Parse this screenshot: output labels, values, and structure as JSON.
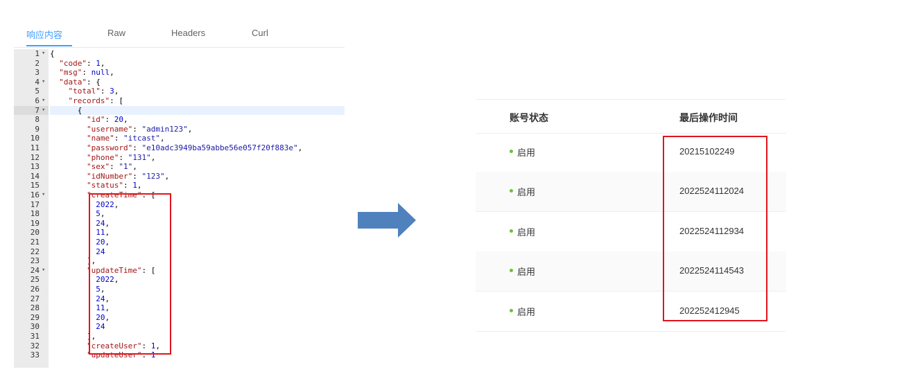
{
  "tabs": [
    {
      "label": "响应内容"
    },
    {
      "label": "Raw"
    },
    {
      "label": "Headers"
    },
    {
      "label": "Curl"
    }
  ],
  "active_tab": "响应内容",
  "code_lines": [
    {
      "n": "1",
      "fold": true,
      "text": "{"
    },
    {
      "n": "2",
      "text": "  \"code\": 1,"
    },
    {
      "n": "3",
      "text": "  \"msg\": null,"
    },
    {
      "n": "4",
      "fold": true,
      "text": "  \"data\": {"
    },
    {
      "n": "5",
      "text": "    \"total\": 3,"
    },
    {
      "n": "6",
      "fold": true,
      "text": "    \"records\": ["
    },
    {
      "n": "7",
      "fold": true,
      "active": true,
      "text": "      {"
    },
    {
      "n": "8",
      "text": "        \"id\": 20,"
    },
    {
      "n": "9",
      "text": "        \"username\": \"admin123\","
    },
    {
      "n": "10",
      "text": "        \"name\": \"itcast\","
    },
    {
      "n": "11",
      "text": "        \"password\": \"e10adc3949ba59abbe56e057f20f883e\","
    },
    {
      "n": "12",
      "text": "        \"phone\": \"131\","
    },
    {
      "n": "13",
      "text": "        \"sex\": \"1\","
    },
    {
      "n": "14",
      "text": "        \"idNumber\": \"123\","
    },
    {
      "n": "15",
      "text": "        \"status\": 1,"
    },
    {
      "n": "16",
      "fold": true,
      "text": "        \"createTime\": ["
    },
    {
      "n": "17",
      "text": "          2022,"
    },
    {
      "n": "18",
      "text": "          5,"
    },
    {
      "n": "19",
      "text": "          24,"
    },
    {
      "n": "20",
      "text": "          11,"
    },
    {
      "n": "21",
      "text": "          20,"
    },
    {
      "n": "22",
      "text": "          24"
    },
    {
      "n": "23",
      "text": "        ],"
    },
    {
      "n": "24",
      "fold": true,
      "text": "        \"updateTime\": ["
    },
    {
      "n": "25",
      "text": "          2022,"
    },
    {
      "n": "26",
      "text": "          5,"
    },
    {
      "n": "27",
      "text": "          24,"
    },
    {
      "n": "28",
      "text": "          11,"
    },
    {
      "n": "29",
      "text": "          20,"
    },
    {
      "n": "30",
      "text": "          24"
    },
    {
      "n": "31",
      "text": "        ],"
    },
    {
      "n": "32",
      "text": "        \"createUser\": 1,"
    },
    {
      "n": "33",
      "text": "        \"updateUser\": 1"
    }
  ],
  "table": {
    "headers": {
      "status": "账号状态",
      "time": "最后操作时间"
    },
    "rows": [
      {
        "status": "启用",
        "time": "20215102249"
      },
      {
        "status": "启用",
        "time": "2022524112024"
      },
      {
        "status": "启用",
        "time": "2022524112934"
      },
      {
        "status": "启用",
        "time": "2022524114543"
      },
      {
        "status": "启用",
        "time": "202252412945"
      }
    ]
  },
  "colors": {
    "accent": "#409eff",
    "highlight_border": "#e0141c",
    "arrow": "#4f81bd",
    "status_dot": "#67c23a"
  }
}
